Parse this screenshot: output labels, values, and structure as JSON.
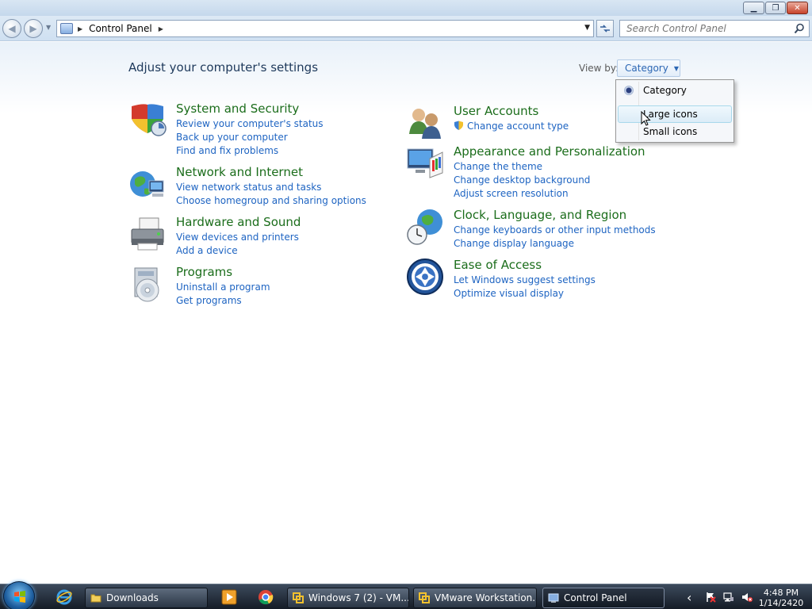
{
  "window": {
    "controls": {
      "minimize": "▁",
      "maximize": "❐",
      "close": "✕"
    }
  },
  "nav": {
    "back_glyph": "◀",
    "forward_glyph": "▶",
    "breadcrumb": [
      "Control Panel"
    ],
    "search_placeholder": "Search Control Panel"
  },
  "page": {
    "title": "Adjust your computer's settings",
    "view_by_label": "View by:",
    "view_by_value": "Category"
  },
  "categories_left": [
    {
      "title": "System and Security",
      "links": [
        "Review your computer's status",
        "Back up your computer",
        "Find and fix problems"
      ],
      "icon": "shield-icon"
    },
    {
      "title": "Network and Internet",
      "links": [
        "View network status and tasks",
        "Choose homegroup and sharing options"
      ],
      "icon": "network-globe-icon"
    },
    {
      "title": "Hardware and Sound",
      "links": [
        "View devices and printers",
        "Add a device"
      ],
      "icon": "printer-icon"
    },
    {
      "title": "Programs",
      "links": [
        "Uninstall a program",
        "Get programs"
      ],
      "icon": "programs-disc-icon"
    }
  ],
  "categories_right": [
    {
      "title": "User Accounts",
      "links": [
        "Change account type"
      ],
      "icon": "users-icon"
    },
    {
      "title": "Appearance and Personalization",
      "links": [
        "Change the theme",
        "Change desktop background",
        "Adjust screen resolution"
      ],
      "icon": "monitor-palette-icon"
    },
    {
      "title": "Clock, Language, and Region",
      "links": [
        "Change keyboards or other input methods",
        "Change display language"
      ],
      "icon": "clock-globe-icon"
    },
    {
      "title": "Ease of Access",
      "links": [
        "Let Windows suggest settings",
        "Optimize visual display"
      ],
      "icon": "ease-of-access-icon"
    }
  ],
  "view_menu": {
    "items": [
      "Category",
      "Large icons",
      "Small icons"
    ],
    "selected": "Category",
    "hovered": "Large icons"
  },
  "taskbar": {
    "buttons": [
      {
        "label": "Downloads",
        "icon": "folder-icon"
      },
      {
        "label": "Windows 7 (2) - VM...",
        "icon": "vmware-icon"
      },
      {
        "label": "VMware Workstation...",
        "icon": "vmware-icon"
      },
      {
        "label": "Control Panel",
        "icon": "control-panel-icon"
      }
    ],
    "active": "Control Panel",
    "tray_chevron": "‹",
    "clock_time": "4:48 PM",
    "clock_date": "1/14/2420"
  },
  "colors": {
    "category_title": "#1b6d1b",
    "link": "#1e64c2",
    "page_title": "#1e395b"
  }
}
